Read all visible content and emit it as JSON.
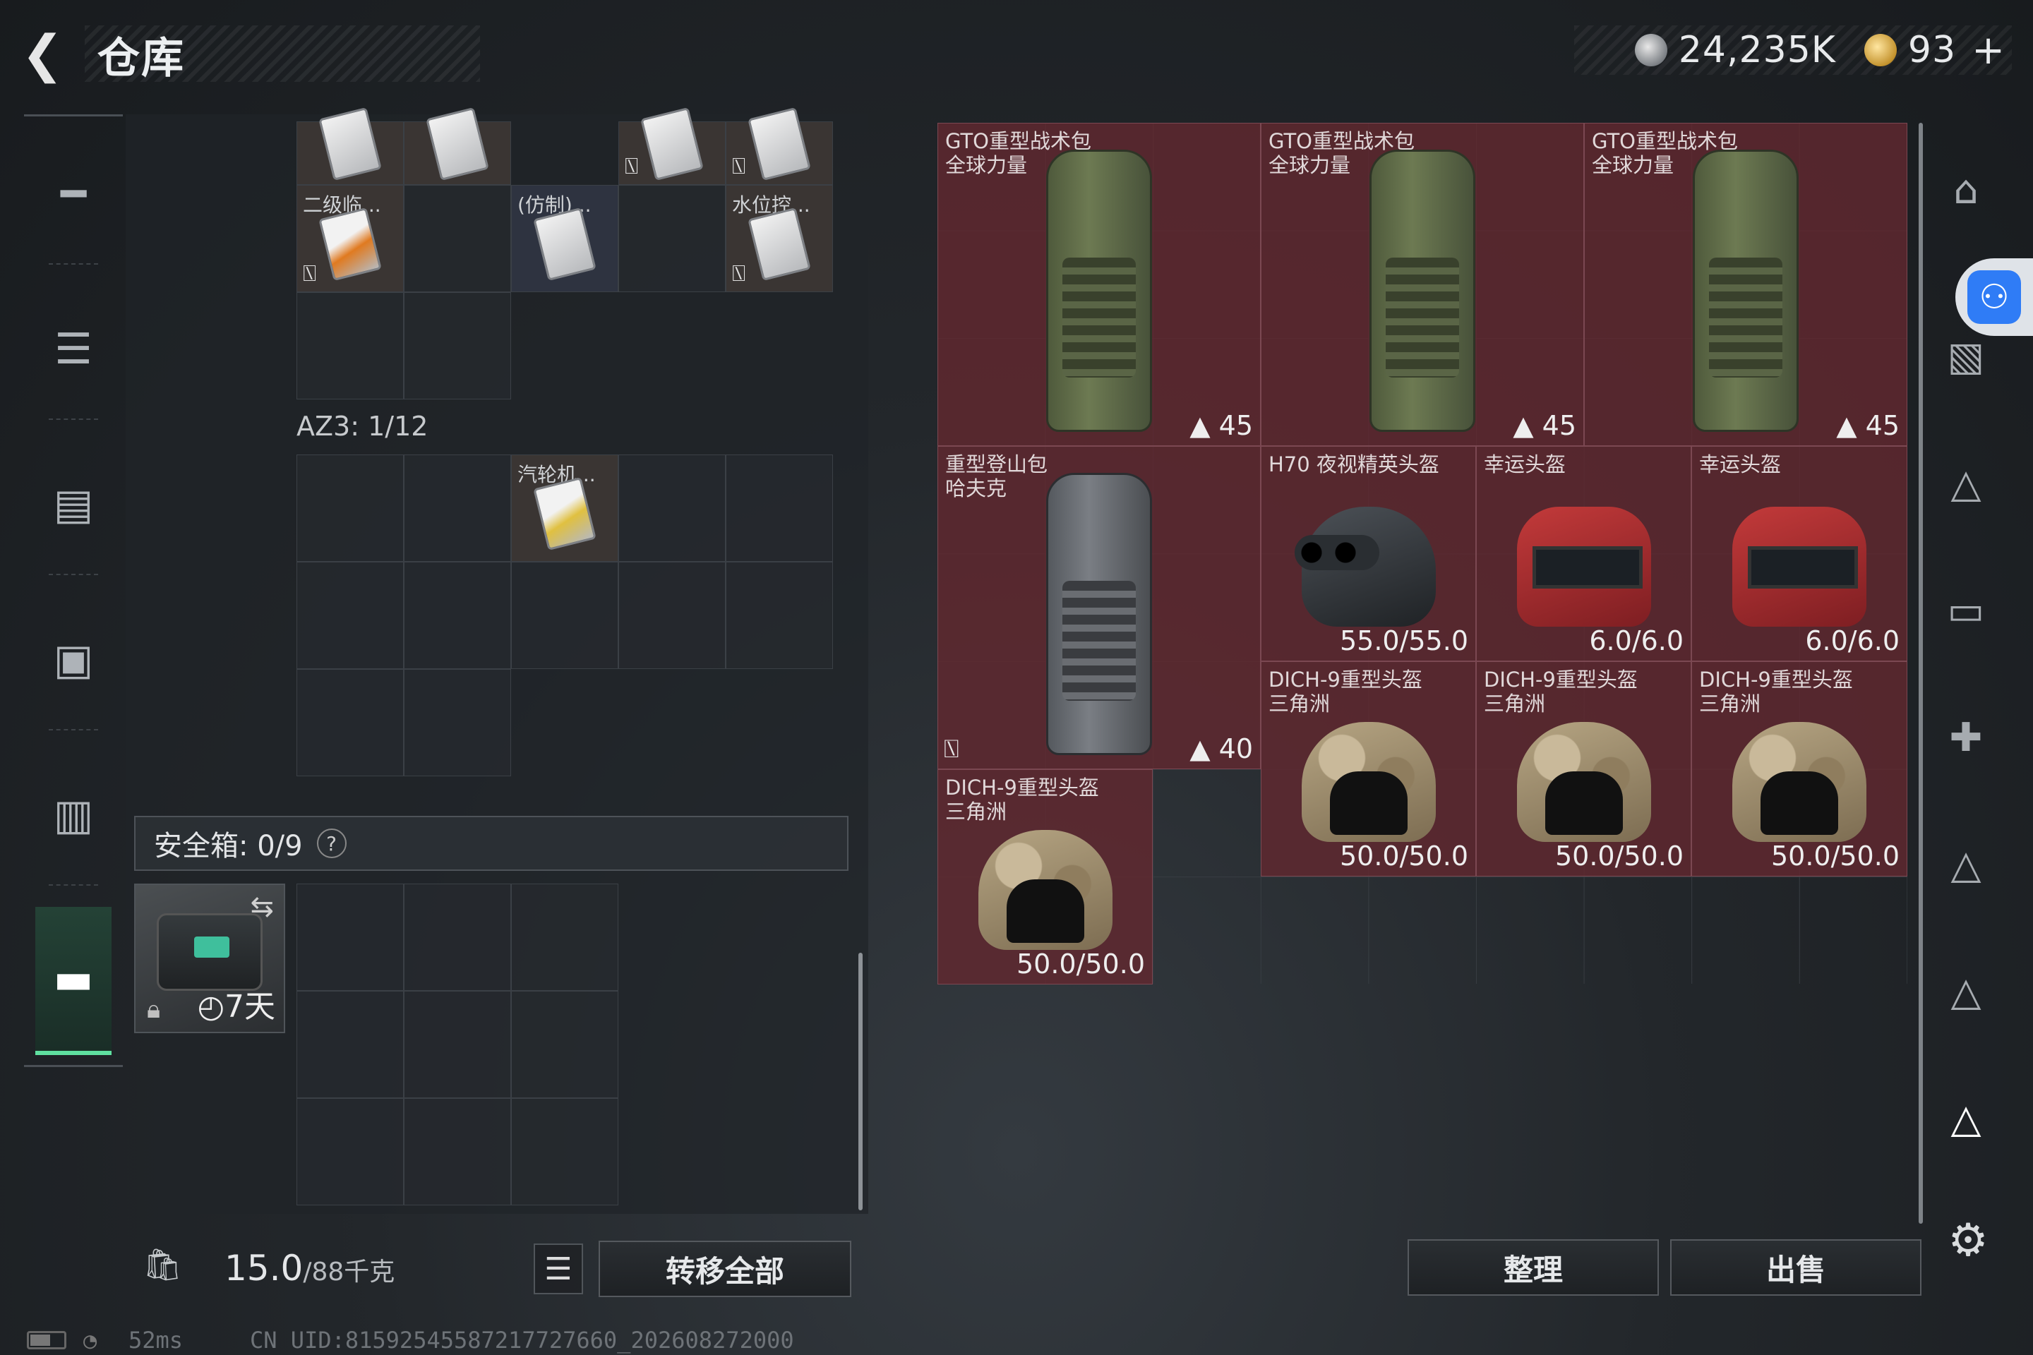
{
  "header": {
    "back_icon": "back-arrow-icon",
    "title": "仓库",
    "silver_value": "24,235K",
    "gold_value": "93",
    "plus": "+"
  },
  "left_nav": [
    "pistol-icon",
    "vest-icon",
    "backpack-icon",
    "armor-icon",
    "rig-icon",
    "briefcase-icon"
  ],
  "inventory": {
    "top_labels": {
      "c1": "二级临...",
      "c2": "(仿制)...",
      "c3": "水位控..."
    },
    "az3_label": "AZ3: 1/12",
    "az3_item": "汽轮机...",
    "safe_label": "安全箱: 0/9",
    "safe_help": "?",
    "safe_days": "7天"
  },
  "footer": {
    "weight": "15.0",
    "weight_unit": "/88千克",
    "transfer": "转移全部"
  },
  "warehouse": {
    "items": [
      {
        "name": "GTO重型战术包\n全球力量",
        "value": "45"
      },
      {
        "name": "GTO重型战术包\n全球力量",
        "value": "45"
      },
      {
        "name": "GTO重型战术包\n全球力量",
        "value": "45"
      },
      {
        "name": "重型登山包\n哈夫克",
        "value": "40"
      },
      {
        "name": "H70 夜视精英头盔",
        "value": "55.0/55.0"
      },
      {
        "name": "幸运头盔",
        "value": "6.0/6.0"
      },
      {
        "name": "幸运头盔",
        "value": "6.0/6.0"
      },
      {
        "name": "DICH-9重型头盔\n三角洲",
        "value": "50.0/50.0"
      },
      {
        "name": "DICH-9重型头盔\n三角洲",
        "value": "50.0/50.0"
      },
      {
        "name": "DICH-9重型头盔\n三角洲",
        "value": "50.0/50.0"
      },
      {
        "name": "DICH-9重型头盔\n三角洲",
        "value": "50.0/50.0"
      }
    ],
    "sort_label": "整理",
    "sell_label": "出售"
  },
  "status": {
    "ping": "52ms",
    "uid": "CN UID:815925455872177276​60_202608272000"
  }
}
